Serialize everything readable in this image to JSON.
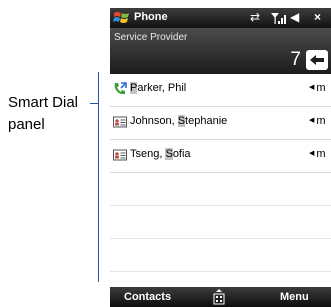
{
  "callout": {
    "line1": "Smart Dial",
    "line2": "panel"
  },
  "title_bar": {
    "app_title": "Phone",
    "icons": [
      "windows-start-icon",
      "connectivity-icon",
      "signal-strength-icon",
      "volume-icon",
      "close-icon"
    ],
    "close_glyph": "×",
    "connectivity_glyph": "⇄",
    "volume_glyph": "◀"
  },
  "dial": {
    "provider": "Service Provider",
    "digits": "7"
  },
  "contacts": [
    {
      "icon": "phone-log-icon",
      "name_parts": [
        "",
        "P",
        "arker, Phil"
      ],
      "type": "m"
    },
    {
      "icon": "contact-card-icon",
      "name_parts": [
        "Johnson, ",
        "S",
        "tephanie"
      ],
      "type": "m"
    },
    {
      "icon": "contact-card-icon",
      "name_parts": [
        "Tseng, ",
        "S",
        "ofia"
      ],
      "type": "m"
    }
  ],
  "soft_keys": {
    "left": "Contacts",
    "right": "Menu"
  },
  "colors": {
    "bar_dark": "#1a1a1a",
    "highlight": "#c2c2c2",
    "callout_line": "#2255aa"
  }
}
